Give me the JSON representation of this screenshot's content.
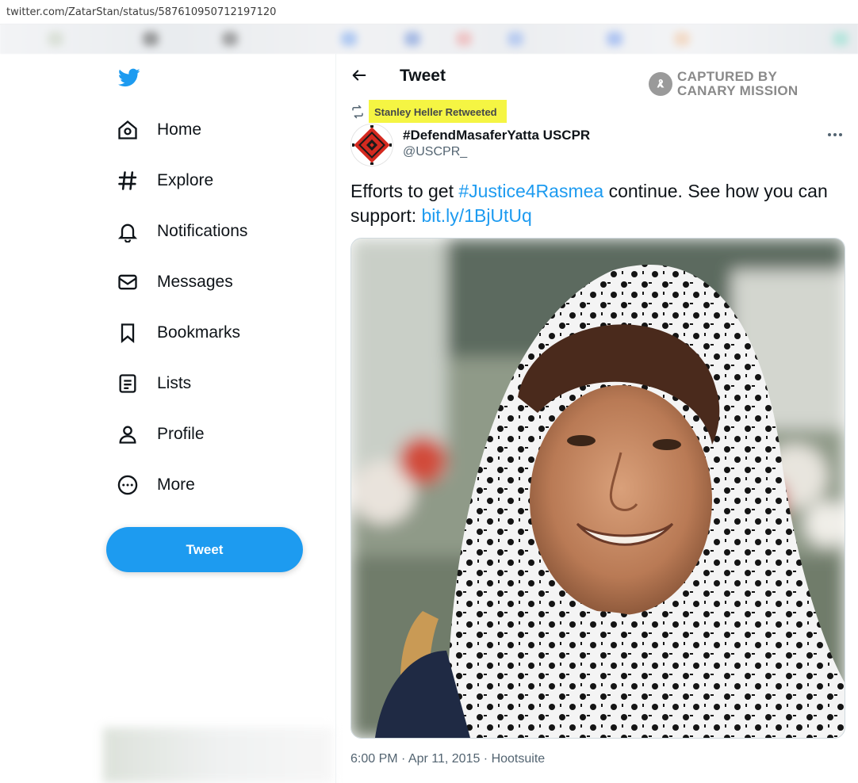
{
  "browser": {
    "url": "twitter.com/ZatarStan/status/587610950712197120"
  },
  "sidebar": {
    "logo": "twitter-bird-icon",
    "items": [
      {
        "label": "Home",
        "icon": "home-icon"
      },
      {
        "label": "Explore",
        "icon": "hashtag-icon"
      },
      {
        "label": "Notifications",
        "icon": "bell-icon"
      },
      {
        "label": "Messages",
        "icon": "envelope-icon"
      },
      {
        "label": "Bookmarks",
        "icon": "bookmark-icon"
      },
      {
        "label": "Lists",
        "icon": "list-icon"
      },
      {
        "label": "Profile",
        "icon": "person-icon"
      },
      {
        "label": "More",
        "icon": "more-circle-icon"
      }
    ],
    "tweet_button": "Tweet"
  },
  "header": {
    "title": "Tweet"
  },
  "watermark": {
    "line1": "CAPTURED BY",
    "line2": "CANARY MISSION"
  },
  "tweet": {
    "retweet_label": "Stanley Heller Retweeted",
    "author_name": "#DefendMasaferYatta USCPR",
    "author_handle": "@USCPR_",
    "text_part1": "Efforts to get ",
    "hashtag": "#Justice4Rasmea",
    "text_part2": " continue. See how you can support: ",
    "link": "bit.ly/1BjUtUq",
    "timestamp": "6:00 PM · Apr 11, 2015 · Hootsuite"
  },
  "colors": {
    "accent": "#1d9bf0",
    "highlight": "#f5f543",
    "text": "#0f1419",
    "muted": "#536471"
  }
}
